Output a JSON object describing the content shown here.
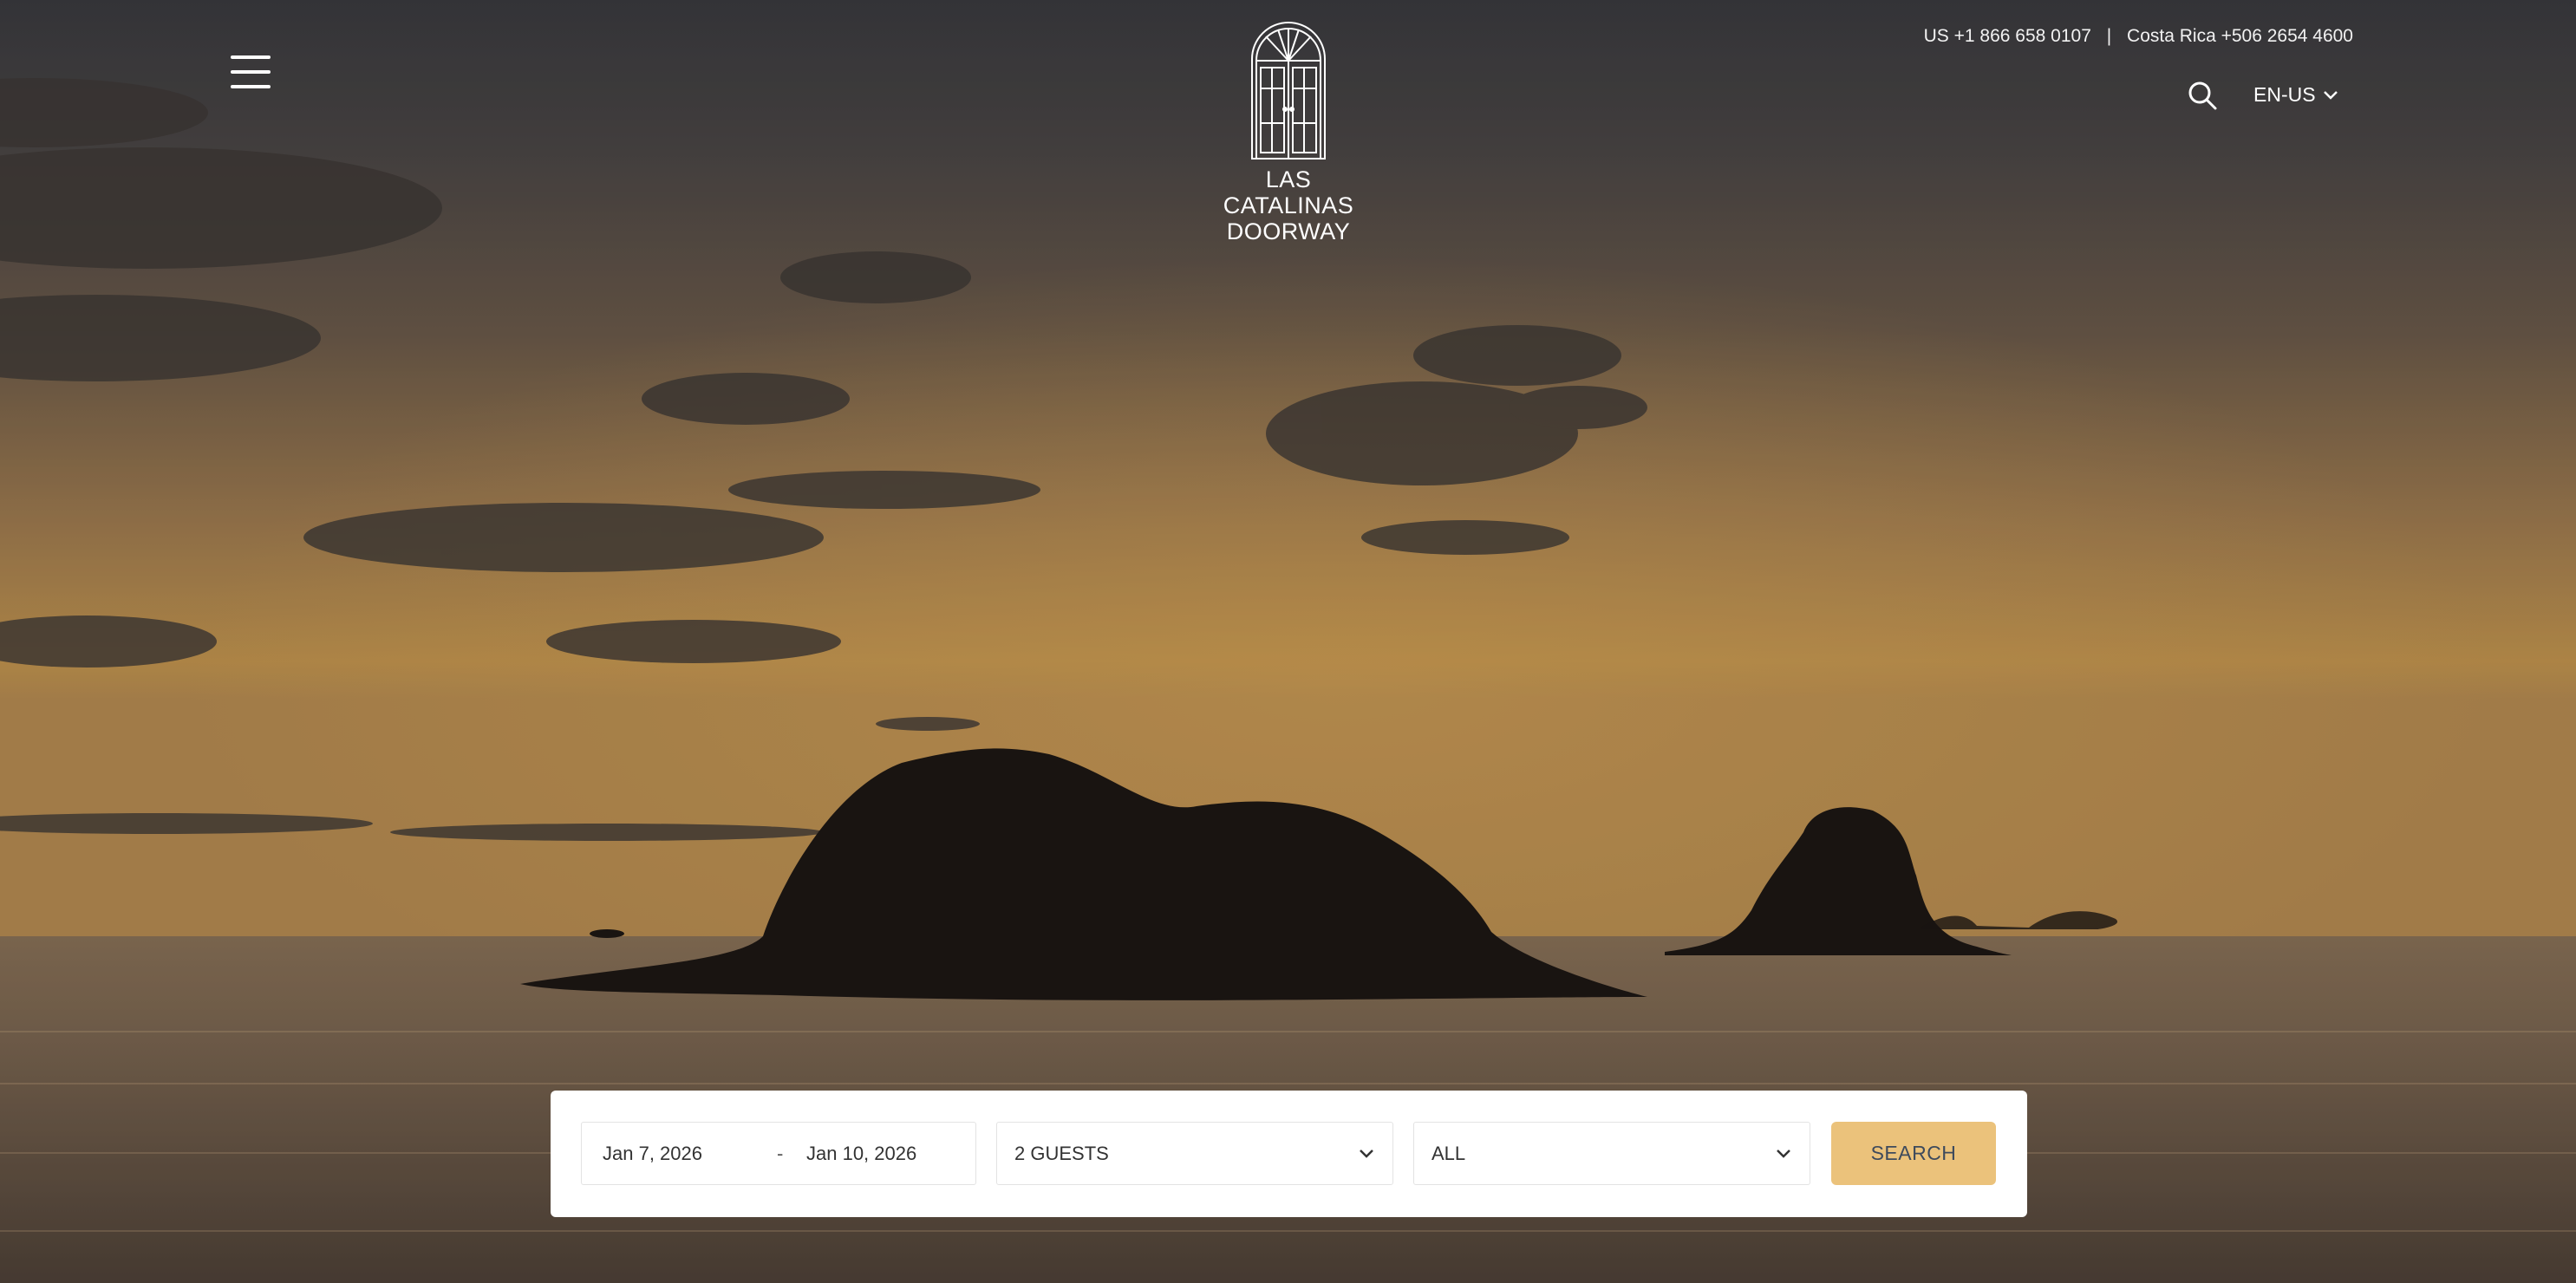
{
  "header": {
    "menu_icon": "hamburger-menu-icon",
    "logo_icon": "arched-doorway-icon",
    "brand_line1": "LAS CATALINAS",
    "brand_line2": "DOORWAY",
    "phone_us": "US +1 866 658 0107",
    "phone_separator": "|",
    "phone_cr": "Costa Rica +506 2654 4600",
    "search_icon": "search-icon",
    "language": "EN-US",
    "language_icon": "chevron-down-icon"
  },
  "booking": {
    "check_in": "Jan 7, 2026",
    "date_separator": "-",
    "check_out": "Jan 10, 2026",
    "guests": "2 GUESTS",
    "category": "ALL",
    "search_label": "SEARCH"
  },
  "colors": {
    "accent": "#ebc27b",
    "button_text": "#3e4a5c",
    "panel": "#ffffff"
  }
}
